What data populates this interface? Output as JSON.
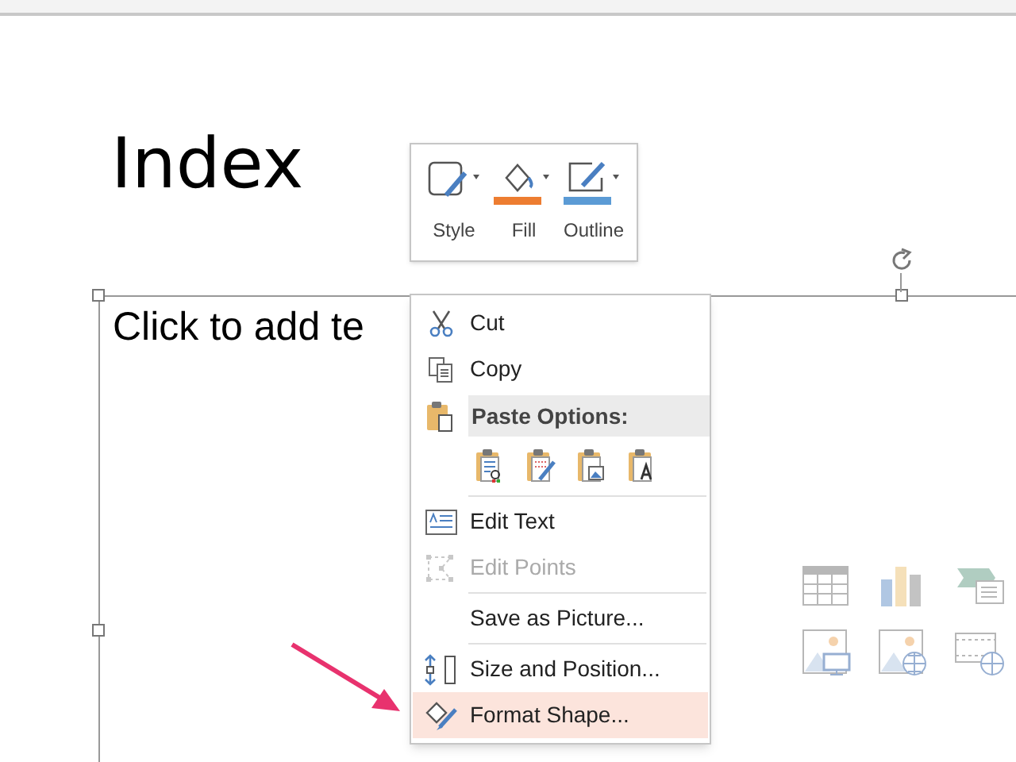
{
  "slide": {
    "title": "Index",
    "body_placeholder": "Click to add te"
  },
  "mini_toolbar": [
    {
      "label": "Style",
      "kind": "style"
    },
    {
      "label": "Fill",
      "kind": "fill",
      "color": "#ed7d31"
    },
    {
      "label": "Outline",
      "kind": "outline",
      "color": "#5b9bd5"
    }
  ],
  "context_menu": [
    {
      "kind": "item",
      "label": "Cut",
      "disabled": false,
      "selected": false
    },
    {
      "kind": "item",
      "label": "Copy",
      "disabled": false,
      "selected": false
    },
    {
      "kind": "header",
      "label": "Paste Options:"
    },
    {
      "kind": "paste-row"
    },
    {
      "kind": "separator"
    },
    {
      "kind": "item",
      "label": "Edit Text",
      "disabled": false,
      "selected": false
    },
    {
      "kind": "item",
      "label": "Edit Points",
      "disabled": true,
      "selected": false
    },
    {
      "kind": "separator"
    },
    {
      "kind": "item",
      "label": "Save as Picture...",
      "disabled": false,
      "selected": false
    },
    {
      "kind": "separator"
    },
    {
      "kind": "item",
      "label": "Size and Position...",
      "disabled": false,
      "selected": false
    },
    {
      "kind": "item",
      "label": "Format Shape...",
      "disabled": false,
      "selected": true
    }
  ]
}
